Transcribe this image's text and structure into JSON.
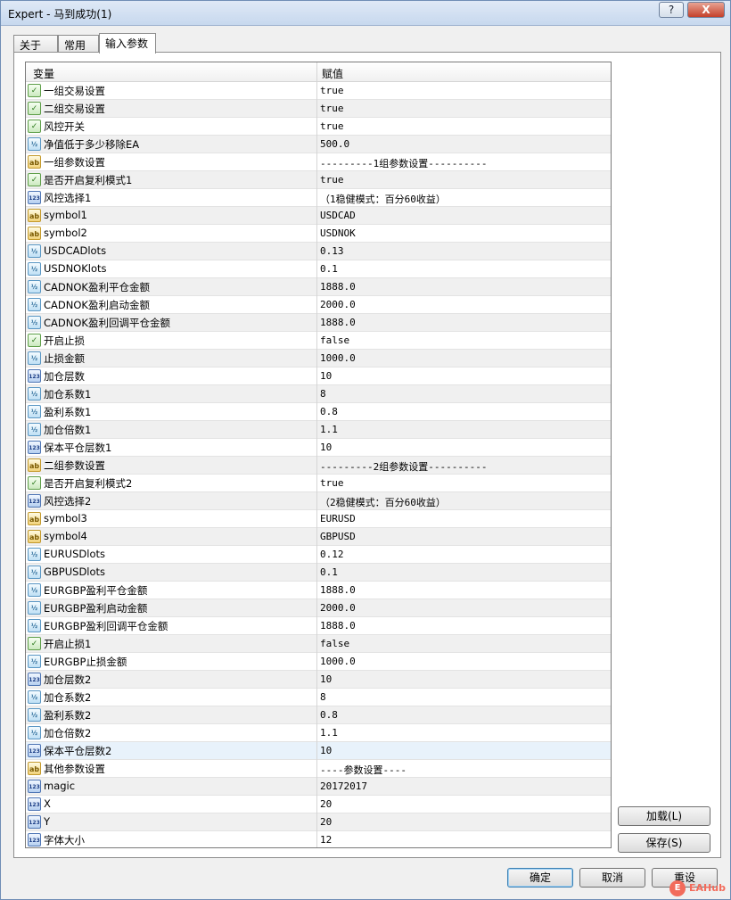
{
  "window": {
    "title": "Expert - 马到成功(1)",
    "help_label": "?",
    "close_label": "X"
  },
  "tabs": [
    {
      "label": "关于"
    },
    {
      "label": "常用"
    },
    {
      "label": "输入参数"
    }
  ],
  "grid": {
    "headers": {
      "variable": "变量",
      "value": "赋值"
    },
    "rows": [
      {
        "type": "bool",
        "name": "一组交易设置",
        "value": "true"
      },
      {
        "type": "bool",
        "name": "二组交易设置",
        "value": "true"
      },
      {
        "type": "bool",
        "name": "风控开关",
        "value": "true"
      },
      {
        "type": "dbl",
        "name": "净值低于多少移除EA",
        "value": "500.0"
      },
      {
        "type": "str",
        "name": "一组参数设置",
        "value": "---------1组参数设置----------"
      },
      {
        "type": "bool",
        "name": "是否开启复利模式1",
        "value": "true"
      },
      {
        "type": "int",
        "name": "风控选择1",
        "value": "（1稳健模式：百分60收益）"
      },
      {
        "type": "str",
        "name": "symbol1",
        "value": "USDCAD"
      },
      {
        "type": "str",
        "name": "symbol2",
        "value": "USDNOK"
      },
      {
        "type": "dbl",
        "name": "USDCADlots",
        "value": "0.13"
      },
      {
        "type": "dbl",
        "name": "USDNOKlots",
        "value": "0.1"
      },
      {
        "type": "dbl",
        "name": "CADNOK盈利平仓金额",
        "value": "1888.0"
      },
      {
        "type": "dbl",
        "name": "CADNOK盈利启动金额",
        "value": "2000.0"
      },
      {
        "type": "dbl",
        "name": "CADNOK盈利回调平仓金额",
        "value": "1888.0"
      },
      {
        "type": "bool",
        "name": "开启止损",
        "value": "false"
      },
      {
        "type": "dbl",
        "name": "止损金额",
        "value": "1000.0"
      },
      {
        "type": "int",
        "name": "加仓层数",
        "value": "10"
      },
      {
        "type": "dbl",
        "name": "加仓系数1",
        "value": "8"
      },
      {
        "type": "dbl",
        "name": "盈利系数1",
        "value": "0.8"
      },
      {
        "type": "dbl",
        "name": "加仓倍数1",
        "value": "1.1"
      },
      {
        "type": "int",
        "name": "保本平仓层数1",
        "value": "10"
      },
      {
        "type": "str",
        "name": "二组参数设置",
        "value": "---------2组参数设置----------"
      },
      {
        "type": "bool",
        "name": "是否开启复利模式2",
        "value": "true"
      },
      {
        "type": "int",
        "name": "风控选择2",
        "value": "（2稳健模式：百分60收益）"
      },
      {
        "type": "str",
        "name": "symbol3",
        "value": "EURUSD"
      },
      {
        "type": "str",
        "name": "symbol4",
        "value": "GBPUSD"
      },
      {
        "type": "dbl",
        "name": "EURUSDlots",
        "value": "0.12"
      },
      {
        "type": "dbl",
        "name": "GBPUSDlots",
        "value": "0.1"
      },
      {
        "type": "dbl",
        "name": "EURGBP盈利平仓金额",
        "value": "1888.0"
      },
      {
        "type": "dbl",
        "name": "EURGBP盈利启动金额",
        "value": "2000.0"
      },
      {
        "type": "dbl",
        "name": "EURGBP盈利回调平仓金额",
        "value": "1888.0"
      },
      {
        "type": "bool",
        "name": "开启止损1",
        "value": "false"
      },
      {
        "type": "dbl",
        "name": "EURGBP止损金额",
        "value": "1000.0"
      },
      {
        "type": "int",
        "name": "加仓层数2",
        "value": "10"
      },
      {
        "type": "dbl",
        "name": "加仓系数2",
        "value": "8"
      },
      {
        "type": "dbl",
        "name": "盈利系数2",
        "value": "0.8"
      },
      {
        "type": "dbl",
        "name": "加仓倍数2",
        "value": "1.1"
      },
      {
        "type": "int",
        "name": "保本平仓层数2",
        "value": "10",
        "selected": true
      },
      {
        "type": "str",
        "name": "其他参数设置",
        "value": "----参数设置----"
      },
      {
        "type": "int",
        "name": "magic",
        "value": "20172017"
      },
      {
        "type": "int",
        "name": "X",
        "value": "20"
      },
      {
        "type": "int",
        "name": "Y",
        "value": "20"
      },
      {
        "type": "int",
        "name": "字体大小",
        "value": "12"
      }
    ]
  },
  "icon_glyphs": {
    "bool": "✓",
    "dbl": "½",
    "str": "ab",
    "int": "123"
  },
  "side_buttons": {
    "load": "加载(L)",
    "save": "保存(S)"
  },
  "bottom_buttons": {
    "ok": "确定",
    "cancel": "取消",
    "reset": "重设"
  },
  "watermark": {
    "logo": "E",
    "text": "EAHub"
  }
}
